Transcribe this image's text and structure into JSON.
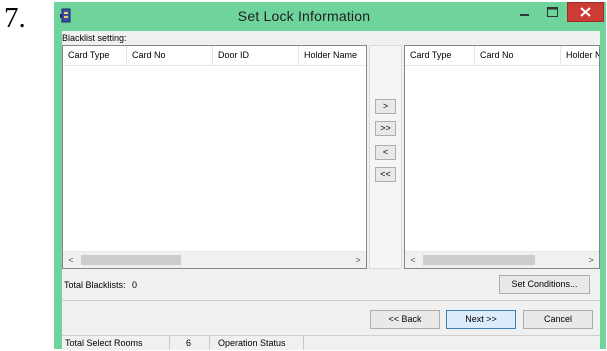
{
  "step_number": "7.",
  "window": {
    "title": "Set Lock Information",
    "minimize_label": "–",
    "maximize_label": "□",
    "close_label": "×"
  },
  "blacklist": {
    "label": "Blacklist setting:",
    "left_columns": [
      "Card Type",
      "Card No",
      "Door ID",
      "Holder Name"
    ],
    "right_columns": [
      "Card Type",
      "Card No",
      "Holder N"
    ],
    "total_label": "Total Blacklists:",
    "total_value": "0"
  },
  "transfer_buttons": {
    "add": ">",
    "add_all": ">>",
    "remove": "<",
    "remove_all": "<<"
  },
  "scrollbar": {
    "left_arrow": "<",
    "right_arrow": ">"
  },
  "buttons": {
    "set_conditions": "Set Conditions...",
    "back": "<< Back",
    "next": "Next >>",
    "cancel": "Cancel"
  },
  "statusbar": {
    "total_rooms_label": "Total Select Rooms",
    "total_rooms_value": "6",
    "operation_status": "Operation Status"
  },
  "colors": {
    "titlebar": "#6fd39c",
    "close_button": "#cd3c34"
  }
}
